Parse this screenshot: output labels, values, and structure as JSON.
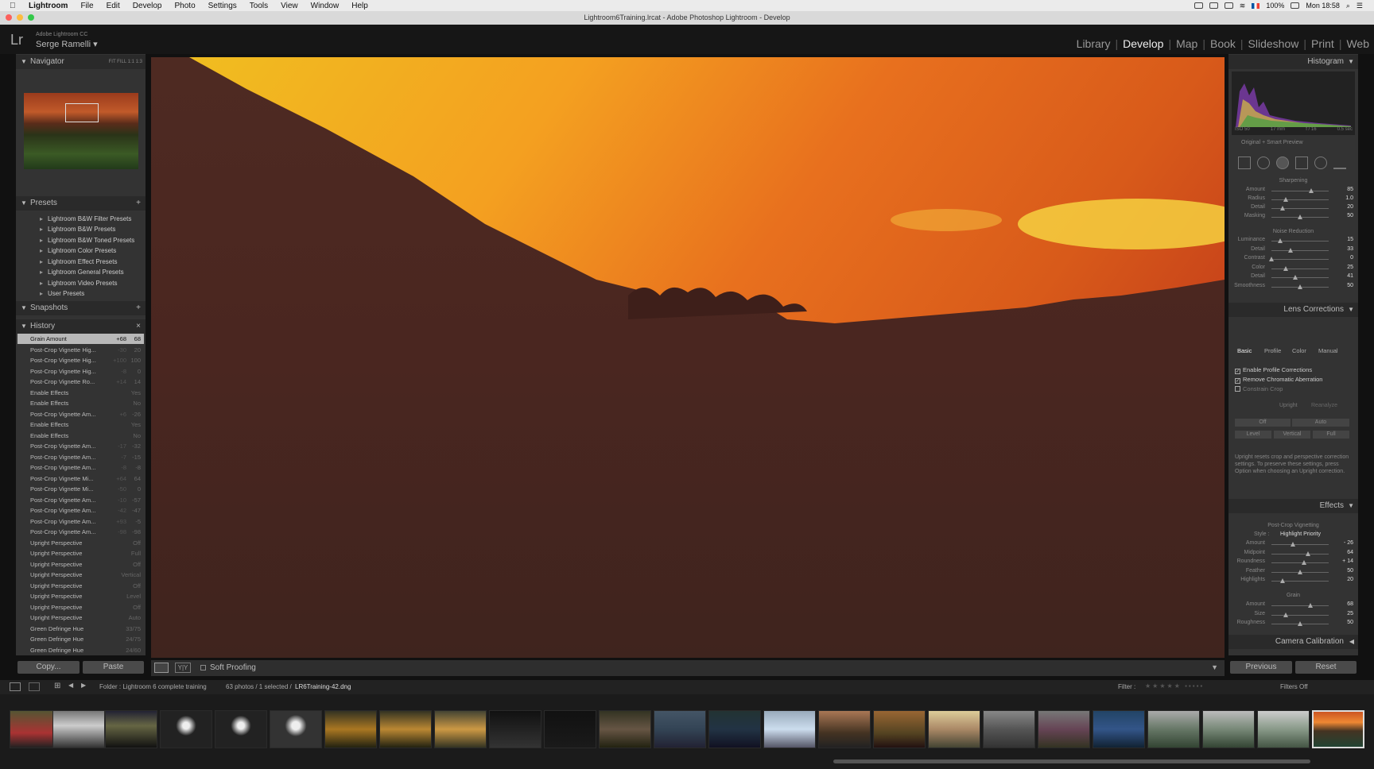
{
  "menubar": {
    "items": [
      "Lightroom",
      "File",
      "Edit",
      "Develop",
      "Photo",
      "Settings",
      "Tools",
      "View",
      "Window",
      "Help"
    ],
    "battery": "100%",
    "clock": "Mon 18:58"
  },
  "window": {
    "title": "Lightroom6Training.lrcat - Adobe Photoshop Lightroom - Develop"
  },
  "identity": {
    "app": "Adobe Lightroom CC",
    "user": "Serge Ramelli"
  },
  "modules": [
    "Library",
    "Develop",
    "Map",
    "Book",
    "Slideshow",
    "Print",
    "Web"
  ],
  "left": {
    "navigator": {
      "title": "Navigator",
      "zoom": [
        "FIT",
        "FILL",
        "1:1",
        "1:3"
      ]
    },
    "presets": {
      "title": "Presets",
      "items": [
        "Lightroom B&W Filter Presets",
        "Lightroom B&W Presets",
        "Lightroom B&W Toned Presets",
        "Lightroom Color Presets",
        "Lightroom Effect Presets",
        "Lightroom General Presets",
        "Lightroom Video Presets",
        "User Presets"
      ]
    },
    "snapshots": {
      "title": "Snapshots"
    },
    "history": {
      "title": "History",
      "items": [
        {
          "name": "Grain Amount",
          "delta": "+68",
          "value": "68"
        },
        {
          "name": "Post-Crop Vignette Hig...",
          "delta": "-30",
          "value": "20"
        },
        {
          "name": "Post-Crop Vignette Hig...",
          "delta": "+100",
          "value": "100"
        },
        {
          "name": "Post-Crop Vignette Hig...",
          "delta": "-8",
          "value": "0"
        },
        {
          "name": "Post-Crop Vignette Ro...",
          "delta": "+14",
          "value": "14"
        },
        {
          "name": "Enable Effects",
          "delta": "",
          "value": "Yes"
        },
        {
          "name": "Enable Effects",
          "delta": "",
          "value": "No"
        },
        {
          "name": "Post-Crop Vignette Am...",
          "delta": "+6",
          "value": "-26"
        },
        {
          "name": "Enable Effects",
          "delta": "",
          "value": "Yes"
        },
        {
          "name": "Enable Effects",
          "delta": "",
          "value": "No"
        },
        {
          "name": "Post-Crop Vignette Am...",
          "delta": "-17",
          "value": "-32"
        },
        {
          "name": "Post-Crop Vignette Am...",
          "delta": "-7",
          "value": "-15"
        },
        {
          "name": "Post-Crop Vignette Am...",
          "delta": "-8",
          "value": "-8"
        },
        {
          "name": "Post-Crop Vignette Mi...",
          "delta": "+64",
          "value": "64"
        },
        {
          "name": "Post-Crop Vignette Mi...",
          "delta": "-50",
          "value": "0"
        },
        {
          "name": "Post-Crop Vignette Am...",
          "delta": "-10",
          "value": "-57"
        },
        {
          "name": "Post-Crop Vignette Am...",
          "delta": "-42",
          "value": "-47"
        },
        {
          "name": "Post-Crop Vignette Am...",
          "delta": "+93",
          "value": "-5"
        },
        {
          "name": "Post-Crop Vignette Am...",
          "delta": "-98",
          "value": "-98"
        },
        {
          "name": "Upright Perspective",
          "delta": "",
          "value": "Off"
        },
        {
          "name": "Upright Perspective",
          "delta": "",
          "value": "Full"
        },
        {
          "name": "Upright Perspective",
          "delta": "",
          "value": "Off"
        },
        {
          "name": "Upright Perspective",
          "delta": "",
          "value": "Vertical"
        },
        {
          "name": "Upright Perspective",
          "delta": "",
          "value": "Off"
        },
        {
          "name": "Upright Perspective",
          "delta": "",
          "value": "Level"
        },
        {
          "name": "Upright Perspective",
          "delta": "",
          "value": "Off"
        },
        {
          "name": "Upright Perspective",
          "delta": "",
          "value": "Auto"
        },
        {
          "name": "Green Defringe Hue",
          "delta": "",
          "value": "33/75"
        },
        {
          "name": "Green Defringe Hue",
          "delta": "",
          "value": "24/75"
        },
        {
          "name": "Green Defringe Hue",
          "delta": "",
          "value": "24/60"
        }
      ]
    },
    "copy_label": "Copy...",
    "paste_label": "Paste"
  },
  "toolbar": {
    "soft_proofing": "Soft Proofing"
  },
  "right": {
    "histogram": {
      "title": "Histogram",
      "info": [
        "ISO 50",
        "17 mm",
        "f / 16",
        "0.5 sec"
      ],
      "preview": "Original + Smart Preview"
    },
    "detail": {
      "sharpening": {
        "title": "Sharpening",
        "rows": [
          {
            "label": "Amount",
            "value": "85",
            "pos": 0.7
          },
          {
            "label": "Radius",
            "value": "1.0",
            "pos": 0.25
          },
          {
            "label": "Detail",
            "value": "20",
            "pos": 0.2
          },
          {
            "label": "Masking",
            "value": "50",
            "pos": 0.5
          }
        ]
      },
      "noise": {
        "title": "Noise Reduction",
        "rows": [
          {
            "label": "Luminance",
            "value": "15",
            "pos": 0.15
          },
          {
            "label": "Detail",
            "value": "33",
            "pos": 0.33
          },
          {
            "label": "Contrast",
            "value": "0",
            "pos": 0.0
          },
          {
            "label": "Color",
            "value": "25",
            "pos": 0.25
          },
          {
            "label": "Detail",
            "value": "41",
            "pos": 0.41
          },
          {
            "label": "Smoothness",
            "value": "50",
            "pos": 0.5
          }
        ]
      }
    },
    "lens": {
      "title": "Lens Corrections",
      "tabs": [
        "Basic",
        "Profile",
        "Color",
        "Manual"
      ],
      "checks": [
        {
          "label": "Enable Profile Corrections",
          "checked": true
        },
        {
          "label": "Remove Chromatic Aberration",
          "checked": true
        },
        {
          "label": "Constrain Crop",
          "checked": false
        }
      ],
      "upright": "Upright",
      "reanalyze": "Reanalyze",
      "buttons": [
        "Off",
        "Auto",
        "Level",
        "Vertical",
        "Full"
      ],
      "help": "Upright resets crop and perspective correction settings. To preserve these settings, press Option when choosing an Upright correction."
    },
    "effects": {
      "title": "Effects",
      "vignette_title": "Post-Crop Vignetting",
      "style_label": "Style :",
      "style_value": "Highlight Priority",
      "vrows": [
        {
          "label": "Amount",
          "value": "- 26",
          "pos": 0.37
        },
        {
          "label": "Midpoint",
          "value": "64",
          "pos": 0.64
        },
        {
          "label": "Roundness",
          "value": "+ 14",
          "pos": 0.57
        },
        {
          "label": "Feather",
          "value": "50",
          "pos": 0.5
        },
        {
          "label": "Highlights",
          "value": "20",
          "pos": 0.2
        }
      ],
      "grain_title": "Grain",
      "grows": [
        {
          "label": "Amount",
          "value": "68",
          "pos": 0.68
        },
        {
          "label": "Size",
          "value": "25",
          "pos": 0.25
        },
        {
          "label": "Roughness",
          "value": "50",
          "pos": 0.5
        }
      ]
    },
    "calibration": "Camera Calibration",
    "previous_label": "Previous",
    "reset_label": "Reset"
  },
  "filmbar": {
    "folder": "Folder : Lightroom 6 complete training",
    "count": "63 photos / 1 selected /",
    "file": "LR6Training-42.dng",
    "filter": "Filter :",
    "filters_off": "Filters Off"
  }
}
